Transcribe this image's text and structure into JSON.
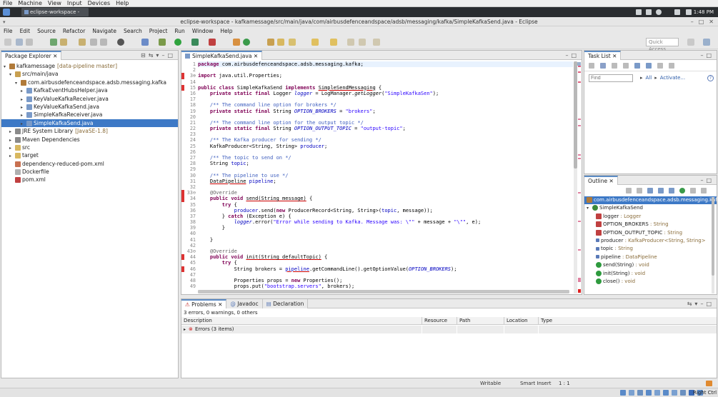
{
  "vm_menu": [
    "File",
    "Machine",
    "View",
    "Input",
    "Devices",
    "Help"
  ],
  "taskbar": {
    "task": "eclipse-workspace - kafkam…",
    "clock": "1:48 PM"
  },
  "window": {
    "title": "eclipse-workspace - kafkamessage/src/main/java/com/airbusdefenceandspace/adsb/messaging/kafka/SimpleKafkaSend.java - Eclipse"
  },
  "menubar": [
    "File",
    "Edit",
    "Source",
    "Refactor",
    "Navigate",
    "Search",
    "Project",
    "Run",
    "Window",
    "Help"
  ],
  "quick_access": "Quick Access",
  "package_explorer": {
    "tab": "Package Explorer",
    "items": [
      {
        "label": "kafkamessage",
        "deco": "[data-pipeline master]",
        "indent": 0,
        "tw": "▾",
        "icon": "project-icon",
        "color": "#b07a3a"
      },
      {
        "label": "src/main/java",
        "deco": "",
        "indent": 1,
        "tw": "▾",
        "icon": "source-folder-icon",
        "color": "#c8a050"
      },
      {
        "label": "com.airbusdefenceandspace.adsb.messaging.kafka",
        "deco": "",
        "indent": 2,
        "tw": "▾",
        "icon": "package-icon",
        "color": "#b07a3a"
      },
      {
        "label": "KafkaEventHubsHelper.java",
        "deco": "",
        "indent": 3,
        "tw": "▸",
        "icon": "java-file-icon",
        "color": "#7a9ac8"
      },
      {
        "label": "KeyValueKafkaReceiver.java",
        "deco": "",
        "indent": 3,
        "tw": "▸",
        "icon": "java-file-icon",
        "color": "#7a9ac8"
      },
      {
        "label": "KeyValueKafkaSend.java",
        "deco": "",
        "indent": 3,
        "tw": "▸",
        "icon": "java-file-icon",
        "color": "#7a9ac8"
      },
      {
        "label": "SimpleKafkaReceiver.java",
        "deco": "",
        "indent": 3,
        "tw": "▸",
        "icon": "java-file-icon",
        "color": "#7a9ac8"
      },
      {
        "label": "SimpleKafkaSend.java",
        "deco": "",
        "indent": 3,
        "tw": "▸",
        "icon": "java-file-icon",
        "color": "#7a9ac8",
        "selected": true
      },
      {
        "label": "JRE System Library",
        "deco": "[JavaSE-1.8]",
        "indent": 1,
        "tw": "▸",
        "icon": "library-icon",
        "color": "#8a8a8a"
      },
      {
        "label": "Maven Dependencies",
        "deco": "",
        "indent": 1,
        "tw": "▸",
        "icon": "library-icon",
        "color": "#8a8a8a"
      },
      {
        "label": "src",
        "deco": "",
        "indent": 1,
        "tw": "▸",
        "icon": "folder-icon",
        "color": "#d8b860"
      },
      {
        "label": "target",
        "deco": "",
        "indent": 1,
        "tw": "▸",
        "icon": "folder-icon",
        "color": "#d8b860"
      },
      {
        "label": "dependency-reduced-pom.xml",
        "deco": "",
        "indent": 1,
        "tw": "",
        "icon": "xml-file-icon",
        "color": "#c87050"
      },
      {
        "label": "Dockerfile",
        "deco": "",
        "indent": 1,
        "tw": "",
        "icon": "file-icon",
        "color": "#b0b0b0"
      },
      {
        "label": "pom.xml",
        "deco": "",
        "indent": 1,
        "tw": "",
        "icon": "maven-file-icon",
        "color": "#c04040"
      }
    ]
  },
  "editor": {
    "tab": "SimpleKafkaSend.java",
    "line_numbers": [
      "1",
      "2",
      "3⊕",
      "14",
      "15",
      "16",
      "17",
      "18",
      "19",
      "20",
      "21",
      "22",
      "23",
      "24",
      "25",
      "26",
      "27",
      "28",
      "29",
      "30",
      "31",
      "32",
      "33⊖",
      "34",
      "35",
      "36",
      "37",
      "38",
      "39",
      "40",
      "41",
      "42",
      "43⊖",
      "44",
      "45",
      "46",
      "47",
      "48",
      "49"
    ],
    "lines": [
      "<span class='kw'>package</span> com.airbusdefenceandspace.adsb.messaging.kafka;",
      "",
      "<span class='kw'>import</span> java.util.Properties;",
      "",
      "<span class='kw'>public class</span> SimpleKafkaSend <span class='kw'>implements</span> <span class='ul'>SimpleSendMessaging</span> {",
      "    <span class='kw'>private static final</span> Logger <span class='fd it'>logger</span> = LogManager.<span class='it'>getLogger</span>(<span class='st'>\"SimpleKafkaSen\"</span>);",
      "",
      "    <span class='cm'>/** The command line option for brokers */</span>",
      "    <span class='kw'>private static final</span> String <span class='fd it'>OPTION_BROKERS</span> = <span class='st'>\"brokers\"</span>;",
      "",
      "    <span class='cm'>/** The command line option for the output topic */</span>",
      "    <span class='kw'>private static final</span> String <span class='fd it'>OPTION_OUTPUT_TOPIC</span> = <span class='st'>\"output-topic\"</span>;",
      "",
      "    <span class='cm'>/** The Kafka producer for sending */</span>",
      "    KafkaProducer&lt;String, String&gt; <span class='fd'>producer</span>;",
      "",
      "    <span class='cm'>/** The topic to send on */</span>",
      "    String <span class='fd'>topic</span>;",
      "",
      "    <span class='cm'>/** The pipeline to use */</span>",
      "    <span class='ul'>DataPipeline</span> <span class='fd'>pipeline</span>;",
      "",
      "    <span class='an'>@Override</span>",
      "    <span class='kw'>public void</span> <span class='ul'>send(String message)</span> {",
      "        <span class='kw'>try</span> {",
      "            <span class='fd'>producer</span>.send(<span class='kw'>new</span> ProducerRecord&lt;String, String&gt;(<span class='fd'>topic</span>, message));",
      "        } <span class='kw'>catch</span> (Exception e) {",
      "            <span class='fd it'>logger</span>.error(<span class='st'>\"Error while sending to Kafka. Message was: \\\"\"</span> + message + <span class='st'>\"\\\"\"</span>, e);",
      "        }",
      "",
      "    }",
      "",
      "    <span class='an'>@Override</span>",
      "    <span class='kw'>public void</span> <span class='ul'>init(String defaultTopic)</span> {",
      "        <span class='kw'>try</span> {",
      "            String brokers = <span class='ul fd'>pipeline</span>.getCommandLine().getOptionValue(<span class='fd it'>OPTION_BROKERS</span>);",
      "",
      "            Properties props = <span class='kw'>new</span> Properties();",
      "            props.put(<span class='st'>\"bootstrap.servers\"</span>, brokers);"
    ]
  },
  "task_list": {
    "tab": "Task List",
    "find_placeholder": "Find",
    "all": "All",
    "activate": "Activate..."
  },
  "outline": {
    "tab": "Outline",
    "items": [
      {
        "label": "com.airbusdefenceandspace.adsb.messaging.kafka",
        "type": "",
        "indent": 0,
        "icon": "package-icon",
        "color": "#b07a3a",
        "selected": true
      },
      {
        "label": "SimpleKafkaSend",
        "type": "",
        "indent": 0,
        "icon": "class-icon",
        "color": "#3a8a3a",
        "tw": "▾"
      },
      {
        "label": "logger",
        "type": " : Logger",
        "indent": 1,
        "icon": "static-field-icon",
        "color": "#c04040"
      },
      {
        "label": "OPTION_BROKERS",
        "type": " : String",
        "indent": 1,
        "icon": "static-field-icon",
        "color": "#c04040"
      },
      {
        "label": "OPTION_OUTPUT_TOPIC",
        "type": " : String",
        "indent": 1,
        "icon": "static-field-icon",
        "color": "#c04040"
      },
      {
        "label": "producer",
        "type": " : KafkaProducer<String, String>",
        "indent": 1,
        "icon": "field-icon",
        "color": "#5a7ab8"
      },
      {
        "label": "topic",
        "type": " : String",
        "indent": 1,
        "icon": "field-icon",
        "color": "#5a7ab8"
      },
      {
        "label": "pipeline",
        "type": " : DataPipeline",
        "indent": 1,
        "icon": "field-icon",
        "color": "#5a7ab8"
      },
      {
        "label": "send(String)",
        "type": " : void",
        "indent": 1,
        "icon": "method-icon",
        "color": "#2e9a3e"
      },
      {
        "label": "init(String)",
        "type": " : void",
        "indent": 1,
        "icon": "method-icon",
        "color": "#2e9a3e"
      },
      {
        "label": "close()",
        "type": " : void",
        "indent": 1,
        "icon": "method-icon",
        "color": "#2e9a3e"
      }
    ]
  },
  "problems": {
    "tabs": [
      "Problems",
      "Javadoc",
      "Declaration"
    ],
    "summary": "3 errors, 0 warnings, 0 others",
    "columns": [
      "Description",
      "Resource",
      "Path",
      "Location",
      "Type"
    ],
    "row": "Errors (3 items)"
  },
  "status": {
    "writable": "Writable",
    "insert": "Smart Insert",
    "pos": "1 : 1"
  },
  "vm_status": {
    "host_key": "Right Ctrl"
  }
}
